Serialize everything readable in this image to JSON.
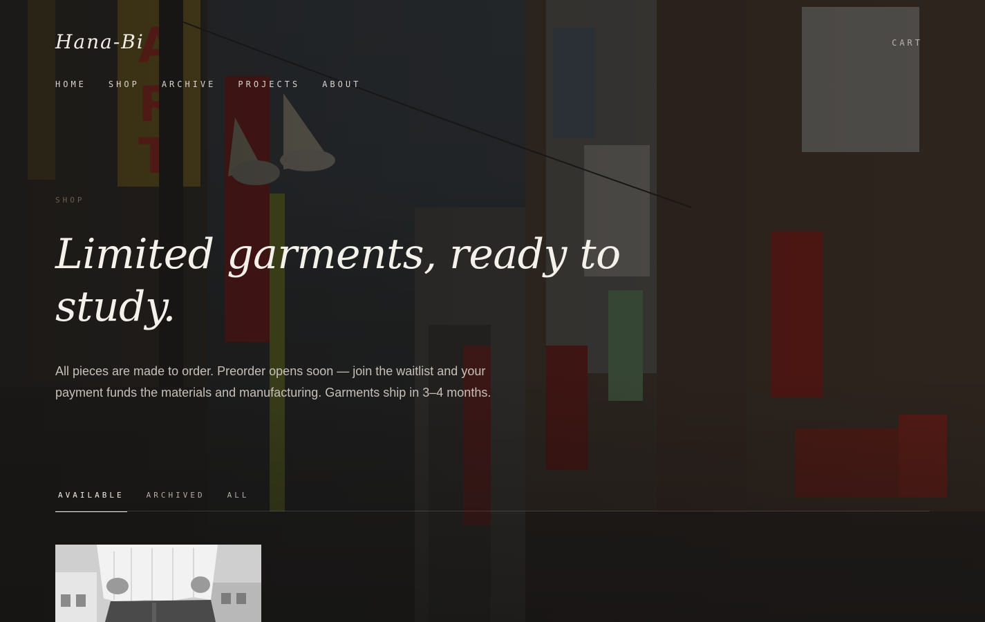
{
  "brand": {
    "name": "Hana-Bi"
  },
  "header": {
    "cart_label": "CART"
  },
  "nav": {
    "items": [
      {
        "label": "HOME"
      },
      {
        "label": "SHOP"
      },
      {
        "label": "ARCHIVE"
      },
      {
        "label": "PROJECTS"
      },
      {
        "label": "ABOUT"
      }
    ]
  },
  "hero": {
    "eyebrow": "SHOP",
    "headline": "Limited garments, ready to study.",
    "lede": "All pieces are made to order. Preorder opens soon — join the waitlist and your payment funds the materials and manufacturing. Garments ship in 3–4 months."
  },
  "tabs": {
    "items": [
      {
        "label": "AVAILABLE",
        "active": true
      },
      {
        "label": "ARCHIVED",
        "active": false
      },
      {
        "label": "ALL",
        "active": false
      }
    ]
  },
  "colors": {
    "background": "#1c1b1a",
    "text": "#e8e4de",
    "eyebrow": "#6e5f4f"
  }
}
